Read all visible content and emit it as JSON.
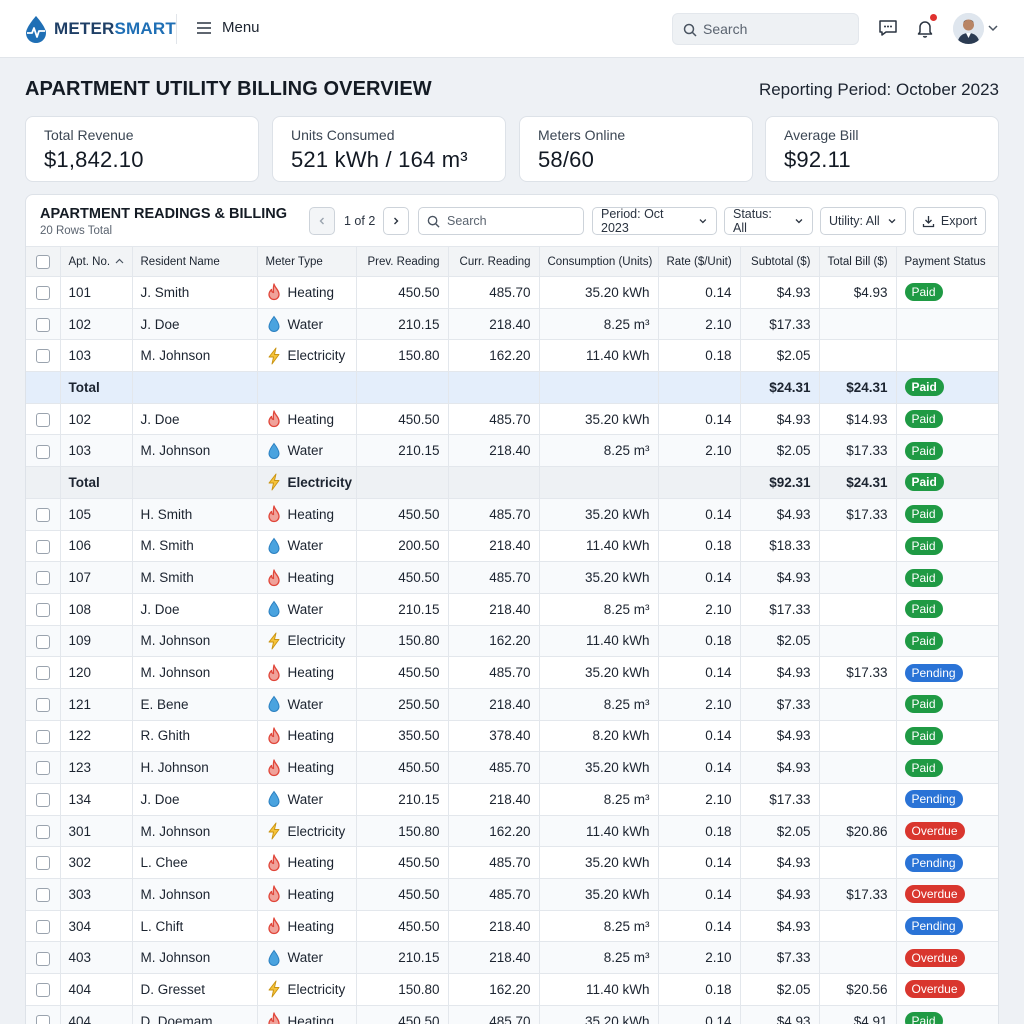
{
  "app": {
    "brand_a": "METER",
    "brand_b": "SMART",
    "menu_label": "Menu",
    "search_placeholder": "Search"
  },
  "header": {
    "title": "APARTMENT UTILITY BILLING OVERVIEW",
    "period": "Reporting Period: October 2023"
  },
  "stats": [
    {
      "label": "Total Revenue",
      "value": "$1,842.10"
    },
    {
      "label": "Units Consumed",
      "value": "521 kWh / 164 m³"
    },
    {
      "label": "Meters Online",
      "value": "58/60"
    },
    {
      "label": "Average Bill",
      "value": "$92.11"
    }
  ],
  "panel": {
    "title": "APARTMENT READINGS & BILLING",
    "subtitle": "20 Rows Total",
    "pagination": "1 of 2",
    "search_placeholder": "Search",
    "filters": {
      "period": "Period: Oct 2023",
      "status": "Status: All",
      "utility": "Utility: All"
    },
    "export_label": "Export"
  },
  "colors": {
    "paid": "#1f9a44",
    "pending": "#2a73d6",
    "overdue": "#d9362e",
    "total_row": "#e4eefb",
    "brand": "#1f6fb5"
  },
  "table": {
    "columns": [
      "Apt. No.",
      "Resident Name",
      "Meter Type",
      "Prev. Reading",
      "Curr. Reading",
      "Consumption (Units)",
      "Rate ($/Unit)",
      "Subtotal ($)",
      "Total Bill ($)",
      "Payment Status"
    ],
    "rows": [
      {
        "kind": "data",
        "apt": "101",
        "name": "J. Smith",
        "type": "Heating",
        "icon": "flame-icon",
        "prev": "450.50",
        "curr": "485.70",
        "cons": "35.20 kWh",
        "rate": "0.14",
        "sub": "$4.93",
        "total": "$4.93",
        "status": "Paid"
      },
      {
        "kind": "data",
        "apt": "102",
        "name": "J. Doe",
        "type": "Water",
        "icon": "droplet-icon",
        "prev": "210.15",
        "curr": "218.40",
        "cons": "8.25 m³",
        "rate": "2.10",
        "sub": "$17.33",
        "total": "",
        "status": ""
      },
      {
        "kind": "data",
        "apt": "103",
        "name": "M. Johnson",
        "type": "Electricity",
        "icon": "bolt-icon",
        "prev": "150.80",
        "curr": "162.20",
        "cons": "11.40 kWh",
        "rate": "0.18",
        "sub": "$2.05",
        "total": "",
        "status": ""
      },
      {
        "kind": "total-blue",
        "apt": "Total",
        "name": "",
        "type": "",
        "icon": "",
        "prev": "",
        "curr": "",
        "cons": "",
        "rate": "",
        "sub": "$24.31",
        "total": "$24.31",
        "status": "Paid"
      },
      {
        "kind": "data",
        "apt": "102",
        "name": "J. Doe",
        "type": "Heating",
        "icon": "flame-icon",
        "prev": "450.50",
        "curr": "485.70",
        "cons": "35.20 kWh",
        "rate": "0.14",
        "sub": "$4.93",
        "total": "$14.93",
        "status": "Paid"
      },
      {
        "kind": "data",
        "apt": "103",
        "name": "M. Johnson",
        "type": "Water",
        "icon": "droplet-icon",
        "prev": "210.15",
        "curr": "218.40",
        "cons": "8.25 m³",
        "rate": "2.10",
        "sub": "$2.05",
        "total": "$17.33",
        "status": "Paid"
      },
      {
        "kind": "total-grey",
        "apt": "Total",
        "name": "",
        "type": "Electricity",
        "icon": "bolt-icon",
        "prev": "",
        "curr": "",
        "cons": "",
        "rate": "",
        "sub": "$92.31",
        "total": "$24.31",
        "status": "Paid"
      },
      {
        "kind": "data",
        "apt": "105",
        "name": "H. Smith",
        "type": "Heating",
        "icon": "flame-icon",
        "prev": "450.50",
        "curr": "485.70",
        "cons": "35.20 kWh",
        "rate": "0.14",
        "sub": "$4.93",
        "total": "$17.33",
        "status": "Paid"
      },
      {
        "kind": "data",
        "apt": "106",
        "name": "M. Smith",
        "type": "Water",
        "icon": "droplet-icon",
        "prev": "200.50",
        "curr": "218.40",
        "cons": "11.40 kWh",
        "rate": "0.18",
        "sub": "$18.33",
        "total": "",
        "status": "Paid"
      },
      {
        "kind": "data",
        "apt": "107",
        "name": "M. Smith",
        "type": "Heating",
        "icon": "flame-icon",
        "prev": "450.50",
        "curr": "485.70",
        "cons": "35.20 kWh",
        "rate": "0.14",
        "sub": "$4.93",
        "total": "",
        "status": "Paid"
      },
      {
        "kind": "data",
        "apt": "108",
        "name": "J. Doe",
        "type": "Water",
        "icon": "droplet-icon",
        "prev": "210.15",
        "curr": "218.40",
        "cons": "8.25 m³",
        "rate": "2.10",
        "sub": "$17.33",
        "total": "",
        "status": "Paid"
      },
      {
        "kind": "data",
        "apt": "109",
        "name": "M. Johnson",
        "type": "Electricity",
        "icon": "bolt-icon",
        "prev": "150.80",
        "curr": "162.20",
        "cons": "11.40 kWh",
        "rate": "0.18",
        "sub": "$2.05",
        "total": "",
        "status": "Paid"
      },
      {
        "kind": "data",
        "apt": "120",
        "name": "M. Johnson",
        "type": "Heating",
        "icon": "flame-icon",
        "prev": "450.50",
        "curr": "485.70",
        "cons": "35.20 kWh",
        "rate": "0.14",
        "sub": "$4.93",
        "total": "$17.33",
        "status": "Pending"
      },
      {
        "kind": "data",
        "apt": "121",
        "name": "E. Bene",
        "type": "Water",
        "icon": "droplet-icon",
        "prev": "250.50",
        "curr": "218.40",
        "cons": "8.25 m³",
        "rate": "2.10",
        "sub": "$7.33",
        "total": "",
        "status": "Paid"
      },
      {
        "kind": "data",
        "apt": "122",
        "name": "R. Ghith",
        "type": "Heating",
        "icon": "flame-icon",
        "prev": "350.50",
        "curr": "378.40",
        "cons": "8.20 kWh",
        "rate": "0.14",
        "sub": "$4.93",
        "total": "",
        "status": "Paid"
      },
      {
        "kind": "data",
        "apt": "123",
        "name": "H. Johnson",
        "type": "Heating",
        "icon": "flame-icon",
        "prev": "450.50",
        "curr": "485.70",
        "cons": "35.20 kWh",
        "rate": "0.14",
        "sub": "$4.93",
        "total": "",
        "status": "Paid"
      },
      {
        "kind": "data",
        "apt": "134",
        "name": "J. Doe",
        "type": "Water",
        "icon": "droplet-icon",
        "prev": "210.15",
        "curr": "218.40",
        "cons": "8.25 m³",
        "rate": "2.10",
        "sub": "$17.33",
        "total": "",
        "status": "Pending"
      },
      {
        "kind": "data",
        "apt": "301",
        "name": "M. Johnson",
        "type": "Electricity",
        "icon": "bolt-icon",
        "prev": "150.80",
        "curr": "162.20",
        "cons": "11.40 kWh",
        "rate": "0.18",
        "sub": "$2.05",
        "total": "$20.86",
        "status": "Overdue"
      },
      {
        "kind": "data",
        "apt": "302",
        "name": "L. Chee",
        "type": "Heating",
        "icon": "flame-icon",
        "prev": "450.50",
        "curr": "485.70",
        "cons": "35.20 kWh",
        "rate": "0.14",
        "sub": "$4.93",
        "total": "",
        "status": "Pending"
      },
      {
        "kind": "data",
        "apt": "303",
        "name": "M. Johnson",
        "type": "Heating",
        "icon": "flame-icon",
        "prev": "450.50",
        "curr": "485.70",
        "cons": "35.20 kWh",
        "rate": "0.14",
        "sub": "$4.93",
        "total": "$17.33",
        "status": "Overdue"
      },
      {
        "kind": "data",
        "apt": "304",
        "name": "L. Chift",
        "type": "Heating",
        "icon": "flame-icon",
        "prev": "450.50",
        "curr": "218.40",
        "cons": "8.25 m³",
        "rate": "0.14",
        "sub": "$4.93",
        "total": "",
        "status": "Pending"
      },
      {
        "kind": "data",
        "apt": "403",
        "name": "M. Johnson",
        "type": "Water",
        "icon": "droplet-icon",
        "prev": "210.15",
        "curr": "218.40",
        "cons": "8.25 m³",
        "rate": "2.10",
        "sub": "$7.33",
        "total": "",
        "status": "Overdue"
      },
      {
        "kind": "data",
        "apt": "404",
        "name": "D. Gresset",
        "type": "Electricity",
        "icon": "bolt-icon",
        "prev": "150.80",
        "curr": "162.20",
        "cons": "11.40 kWh",
        "rate": "0.18",
        "sub": "$2.05",
        "total": "$20.56",
        "status": "Overdue"
      },
      {
        "kind": "data",
        "apt": "404",
        "name": "D. Doemam",
        "type": "Heating",
        "icon": "flame-icon",
        "prev": "450.50",
        "curr": "485.70",
        "cons": "35.20 kWh",
        "rate": "0.14",
        "sub": "$4.93",
        "total": "$4.91",
        "status": "Paid"
      }
    ]
  }
}
